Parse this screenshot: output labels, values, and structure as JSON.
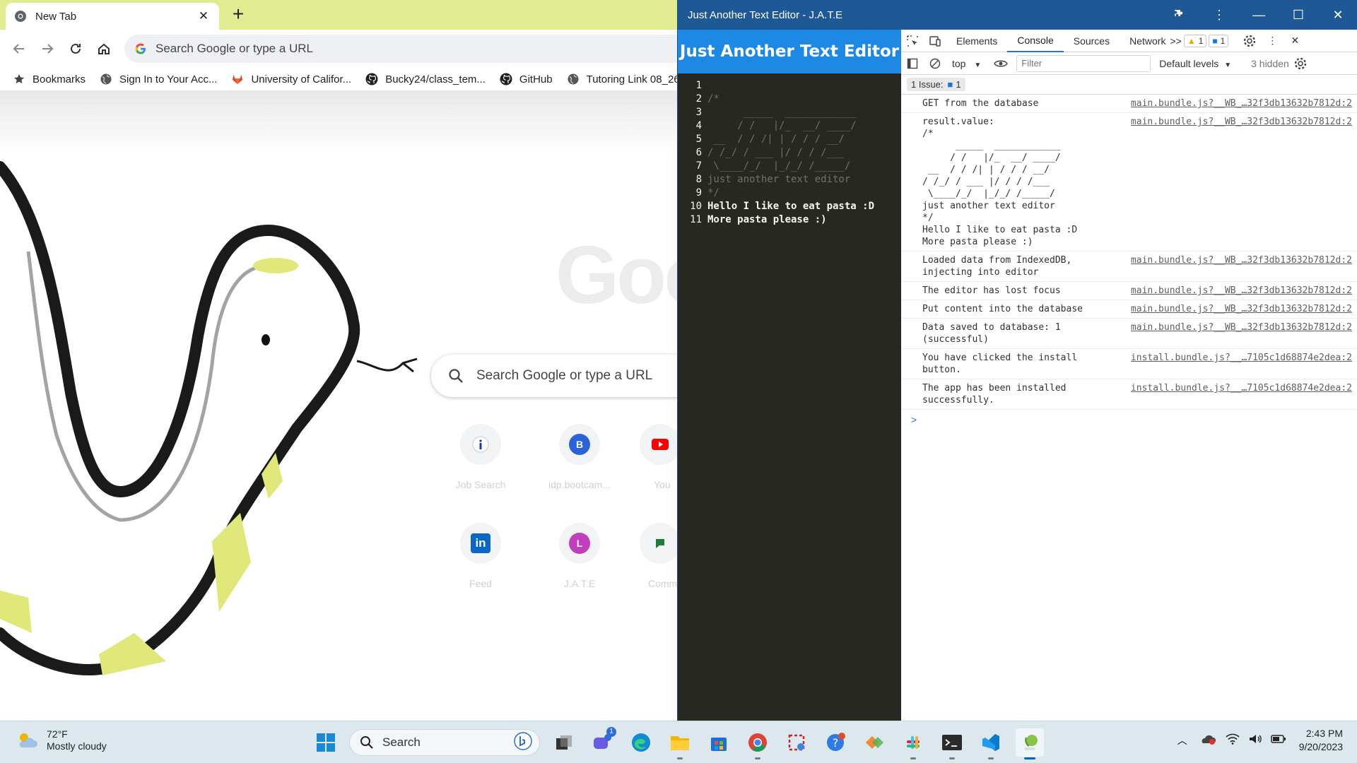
{
  "chrome": {
    "tab_title": "New Tab",
    "omnibox_placeholder": "Search Google or type a URL",
    "bookmarks": [
      {
        "icon": "star-icon",
        "label": "Bookmarks"
      },
      {
        "icon": "globe-icon",
        "label": "Sign In to Your Acc..."
      },
      {
        "icon": "gitlab-icon",
        "label": "University of Califor..."
      },
      {
        "icon": "github-icon",
        "label": "Bucky24/class_tem..."
      },
      {
        "icon": "github-icon",
        "label": "GitHub"
      },
      {
        "icon": "globe-icon",
        "label": "Tutoring Link 08_26"
      }
    ],
    "ntp": {
      "logo": "Goo",
      "search_placeholder": "Search Google or type a URL",
      "shortcuts": [
        {
          "label": "Job Search",
          "icon": "info-icon"
        },
        {
          "label": "idp.bootcam...",
          "icon": "B"
        },
        {
          "label": "You",
          "icon": "youtube-icon"
        },
        {
          "label": "Feed",
          "icon": "in"
        },
        {
          "label": "J.A.T.E",
          "icon": "L"
        },
        {
          "label": "Comm",
          "icon": "community-icon"
        }
      ]
    }
  },
  "jate": {
    "window_title": "Just Another Text Editor - J.A.T.E",
    "app_title": "Just Another Text Editor",
    "editor_lines": [
      {
        "n": "1",
        "text": "",
        "kind": "plain"
      },
      {
        "n": "2",
        "text": "/*",
        "kind": "comment"
      },
      {
        "n": "3",
        "text": "      _____  ____________",
        "kind": "comment"
      },
      {
        "n": "4",
        "text": "     / /   |/_  __/ ____/",
        "kind": "comment"
      },
      {
        "n": "5",
        "text": " __  / / /| | / / / __/",
        "kind": "comment"
      },
      {
        "n": "6",
        "text": "/ /_/ / ___ |/ / / /___",
        "kind": "comment"
      },
      {
        "n": "7",
        "text": " \\____/_/  |_/_/ /_____/",
        "kind": "comment"
      },
      {
        "n": "8",
        "text": "just another text editor",
        "kind": "comment"
      },
      {
        "n": "9",
        "text": "*/",
        "kind": "comment"
      },
      {
        "n": "10",
        "text": "Hello I like to eat pasta :D",
        "kind": "plain"
      },
      {
        "n": "11",
        "text": "More pasta please :)",
        "kind": "plain"
      }
    ]
  },
  "devtools": {
    "tabs": [
      "Elements",
      "Console",
      "Sources",
      "Network"
    ],
    "active_tab": "Console",
    "more_tabs": ">>",
    "warnings_count": "1",
    "messages_count": "1",
    "context": "top",
    "filter_placeholder": "Filter",
    "levels": "Default levels",
    "hidden": "3 hidden",
    "issues_label": "1 Issue:",
    "issues_count": "1",
    "logs": [
      {
        "msg": "GET from the database",
        "src": "main.bundle.js?__WB_…32f3db13632b7812d:2"
      },
      {
        "msg": "result.value:\n/*\n      _____  ____________\n     / /   |/_  __/ ____/\n __  / / /| | / / / __/\n/ /_/ / ___ |/ / / /___\n \\____/_/  |_/_/ /_____/\njust another text editor\n*/\nHello I like to eat pasta :D\nMore pasta please :)",
        "src": "main.bundle.js?__WB_…32f3db13632b7812d:2"
      },
      {
        "msg": "Loaded data from IndexedDB,\ninjecting into editor",
        "src": "main.bundle.js?__WB_…32f3db13632b7812d:2"
      },
      {
        "msg": "The editor has lost focus",
        "src": "main.bundle.js?__WB_…32f3db13632b7812d:2"
      },
      {
        "msg": "Put content into the database",
        "src": "main.bundle.js?__WB_…32f3db13632b7812d:2"
      },
      {
        "msg": "Data saved to database: 1\n(successful)",
        "src": "main.bundle.js?__WB_…32f3db13632b7812d:2"
      },
      {
        "msg": "You have clicked the install\nbutton.",
        "src": "install.bundle.js?__…7105c1d68874e2dea:2"
      },
      {
        "msg": "The app has been installed\nsuccessfully.",
        "src": "install.bundle.js?__…7105c1d68874e2dea:2"
      }
    ],
    "prompt": ">"
  },
  "taskbar": {
    "temp": "72°F",
    "weather": "Mostly cloudy",
    "search": "Search",
    "teams_badge": "1",
    "time": "2:43 PM",
    "date": "9/20/2023"
  },
  "colors": {
    "tabstrip": "#e1eb8f",
    "jate_titlebar": "#1f5896",
    "jate_header": "#1e88e5",
    "editor_bg": "#272822"
  }
}
